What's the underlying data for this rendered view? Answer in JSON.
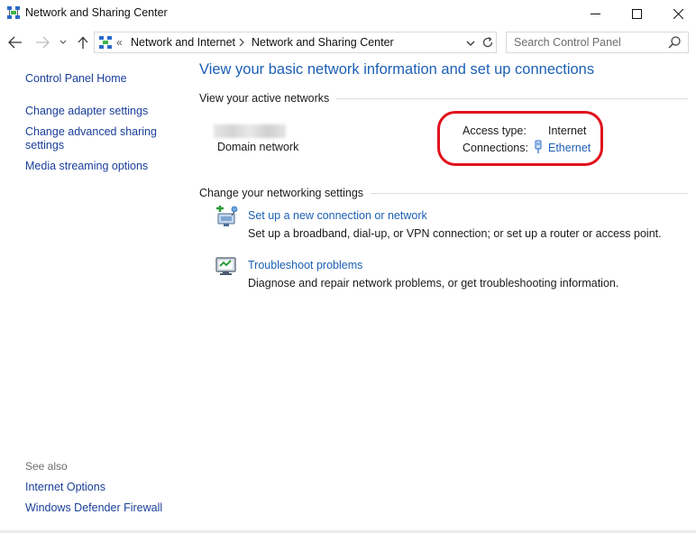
{
  "window": {
    "title": "Network and Sharing Center",
    "icon": "network-center-icon"
  },
  "addressbar": {
    "overflow_glyph": "«",
    "crumbs": [
      "Network and Internet",
      "Network and Sharing Center"
    ]
  },
  "search": {
    "placeholder": "Search Control Panel"
  },
  "leftnav": {
    "home": "Control Panel Home",
    "adapter": "Change adapter settings",
    "advanced": "Change advanced sharing settings",
    "streaming": "Media streaming options",
    "see_also": "See also",
    "internet_options": "Internet Options",
    "firewall": "Windows Defender Firewall"
  },
  "main": {
    "heading": "View your basic network information and set up connections",
    "active_header": "View your active networks",
    "network": {
      "category": "Domain network",
      "access_type_label": "Access type:",
      "access_type_value": "Internet",
      "connections_label": "Connections:",
      "connections_value": "Ethernet"
    },
    "change_header": "Change your networking settings",
    "tasks": [
      {
        "link": "Set up a new connection or network",
        "desc": "Set up a broadband, dial-up, or VPN connection; or set up a router or access point.",
        "icon": "new-connection-icon"
      },
      {
        "link": "Troubleshoot problems",
        "desc": "Diagnose and repair network problems, or get troubleshooting information.",
        "icon": "troubleshoot-icon"
      }
    ]
  },
  "colors": {
    "link": "#1c5fb4",
    "nav_link": "#1a3f9a",
    "highlight": "#e0101c"
  }
}
